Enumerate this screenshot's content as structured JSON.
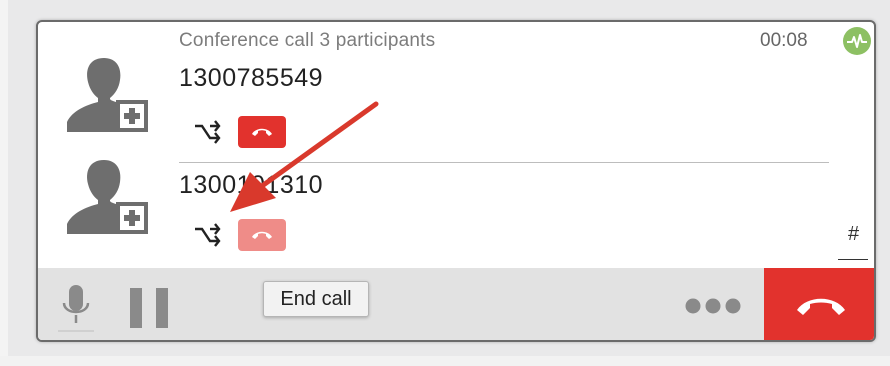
{
  "call": {
    "title": "Conference call 3 participants",
    "timer": "00:08",
    "quality_icon": "activity-icon",
    "quality_color": "#8dc063"
  },
  "participants": [
    {
      "number": "1300785549",
      "transfer_icon": "transfer-icon",
      "hangup_icon": "phone-hangup-icon",
      "hangup_color": "#e2322d"
    },
    {
      "number": "1300101310",
      "transfer_icon": "transfer-icon",
      "hangup_icon": "phone-hangup-icon",
      "hangup_color": "#ef8c88"
    }
  ],
  "dialpad": {
    "label": "#"
  },
  "toolbar": {
    "mic_icon": "microphone-icon",
    "pause_icon": "pause-icon",
    "more_icon": "more-dots-icon",
    "end_call_icon": "phone-hangup-icon",
    "end_call_color": "#e2322d"
  },
  "tooltip": {
    "text": "End call"
  },
  "annotation": {
    "color": "#d9392c"
  }
}
